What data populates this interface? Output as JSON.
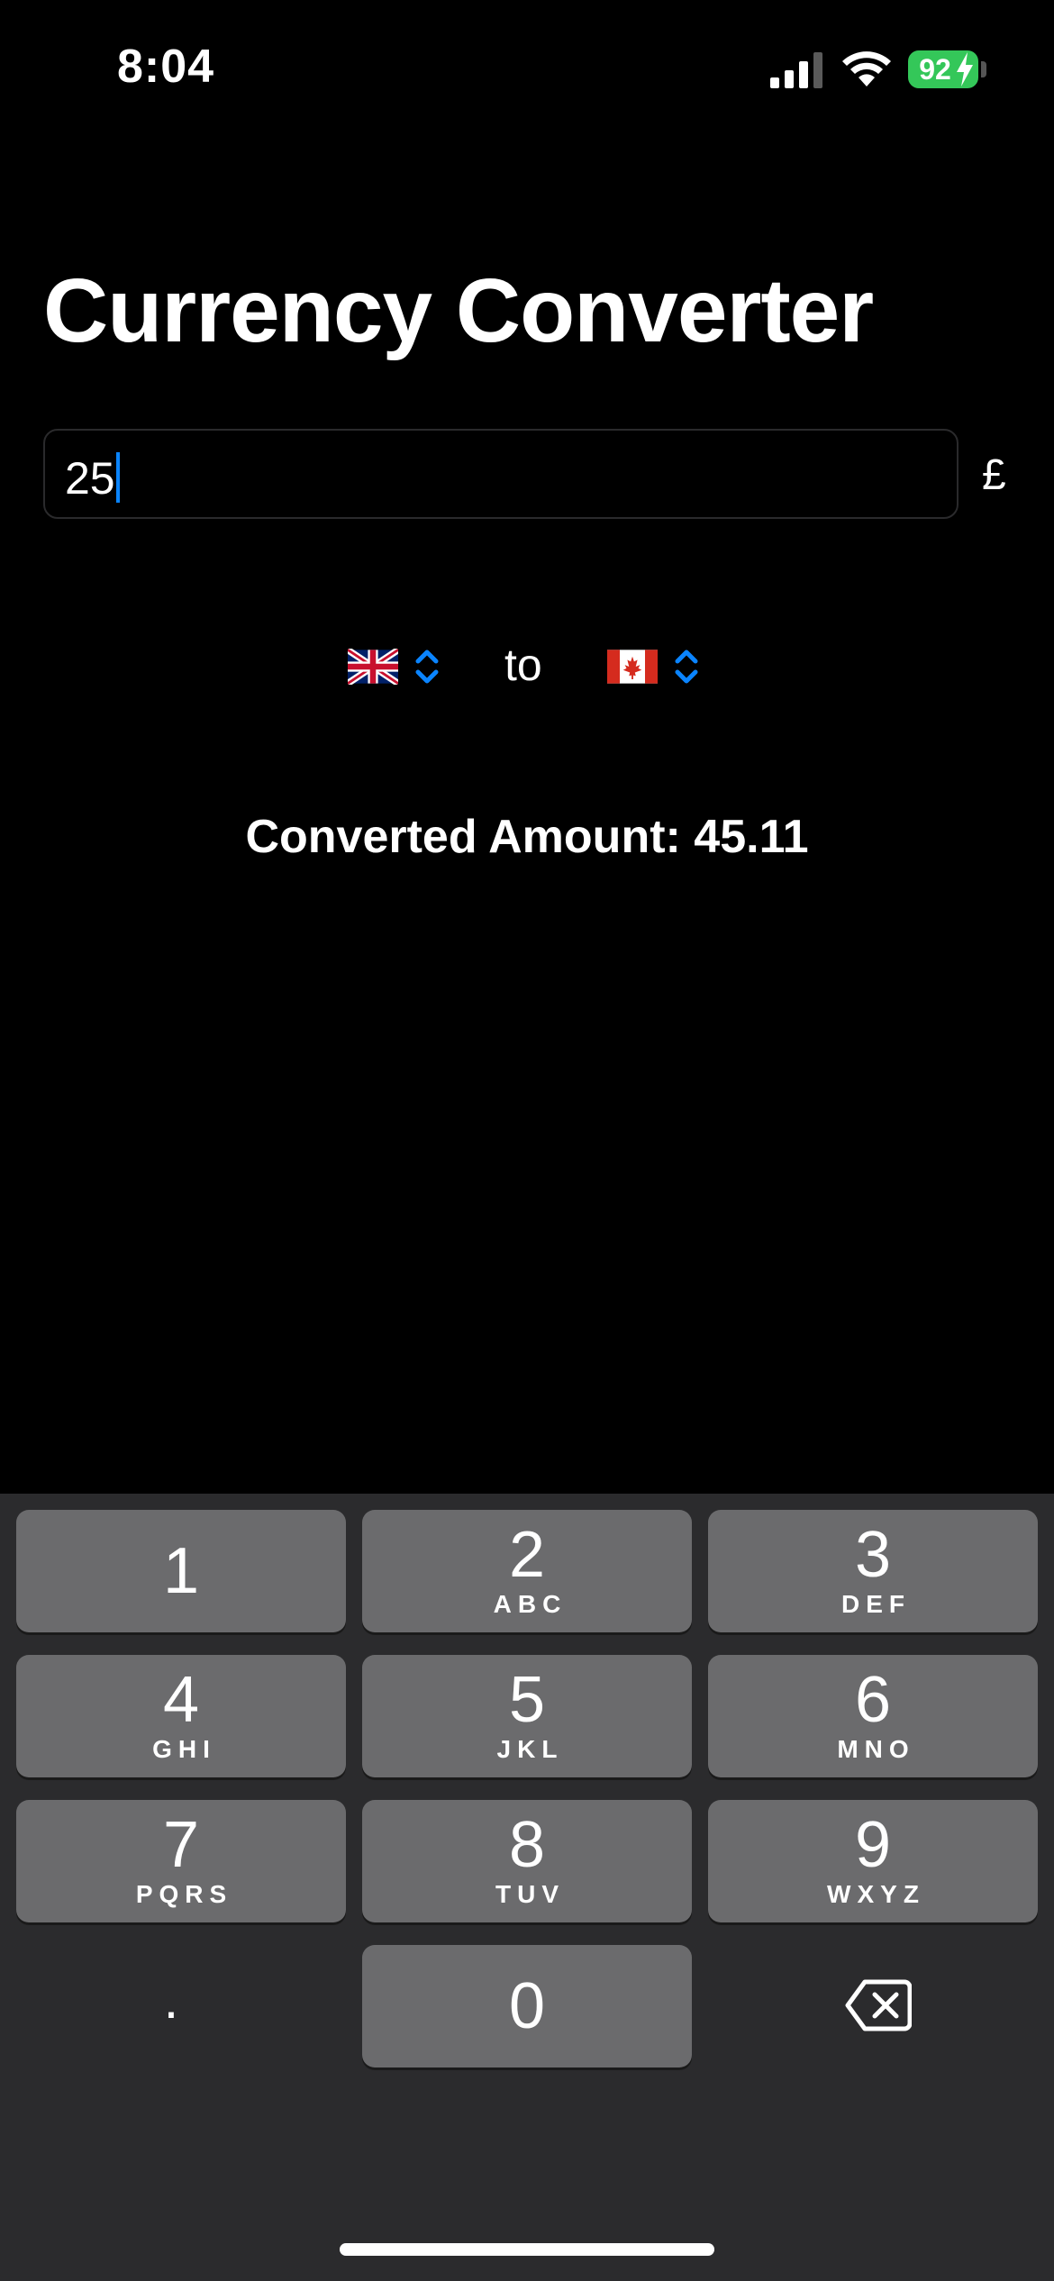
{
  "status_bar": {
    "time": "8:04",
    "battery_percent": "92",
    "icons": [
      "cellular-signal-icon",
      "wifi-icon",
      "battery-charging-icon"
    ],
    "battery_color": "#34c759"
  },
  "header": {
    "title": "Currency Converter"
  },
  "amount_input": {
    "value": "25",
    "currency_symbol": "£",
    "cursor_color": "#0a84ff"
  },
  "pickers": {
    "from_currency_flag": "united-kingdom-flag",
    "to_label": "to",
    "to_currency_flag": "canada-flag",
    "chevron_color": "#0a84ff"
  },
  "result": {
    "label": "Converted Amount: 45.11"
  },
  "keyboard": {
    "keys": [
      {
        "digit": "1",
        "letters": ""
      },
      {
        "digit": "2",
        "letters": "ABC"
      },
      {
        "digit": "3",
        "letters": "DEF"
      },
      {
        "digit": "4",
        "letters": "GHI"
      },
      {
        "digit": "5",
        "letters": "JKL"
      },
      {
        "digit": "6",
        "letters": "MNO"
      },
      {
        "digit": "7",
        "letters": "PQRS"
      },
      {
        "digit": "8",
        "letters": "TUV"
      },
      {
        "digit": "9",
        "letters": "WXYZ"
      },
      {
        "digit": "0",
        "letters": ""
      }
    ],
    "decimal_key": ".",
    "delete_key_icon": "delete-backspace-icon"
  }
}
